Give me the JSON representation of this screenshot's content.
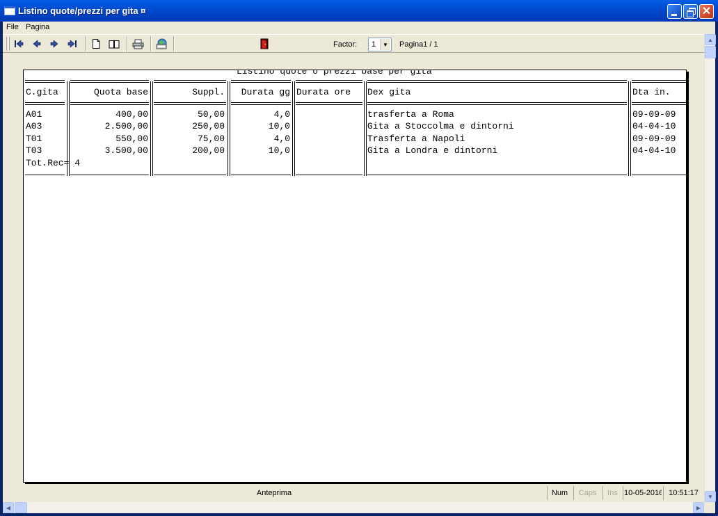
{
  "window": {
    "title": "Listino quote/prezzi per gita ¤",
    "close_glyph": "✕"
  },
  "menu": {
    "items": [
      {
        "label": "File"
      },
      {
        "label": "Pagina"
      }
    ]
  },
  "toolbar": {
    "icons": [
      "first-page-icon",
      "previous-page-icon",
      "next-page-icon",
      "last-page-icon",
      "single-page-icon",
      "two-pages-icon",
      "printer-icon",
      "export-icon",
      "exit-door-icon"
    ],
    "factor_label": "Factor:",
    "factor_value": "1",
    "page_indicator": "Pagina1 / 1"
  },
  "report": {
    "title": "Listino quote o prezzi base per gita",
    "headers": [
      "C.gita",
      "Quota base",
      "Suppl.",
      "Durata gg",
      "Durata ore",
      "Dex gita",
      "Dta in."
    ],
    "rows": [
      {
        "code": "A01",
        "quota": "400,00",
        "suppl": "50,00",
        "gg": "4,0",
        "ore": "",
        "dex": "trasferta a Roma",
        "dta": "09-09-09"
      },
      {
        "code": "A03",
        "quota": "2.500,00",
        "suppl": "250,00",
        "gg": "10,0",
        "ore": "",
        "dex": "Gita a Stoccolma e dintorni",
        "dta": "04-04-10"
      },
      {
        "code": "T01",
        "quota": "550,00",
        "suppl": "75,00",
        "gg": "4,0",
        "ore": "",
        "dex": "Trasferta a Napoli",
        "dta": "09-09-09"
      },
      {
        "code": "T03",
        "quota": "3.500,00",
        "suppl": "200,00",
        "gg": "10,0",
        "ore": "",
        "dex": "Gita a Londra e dintorni",
        "dta": "04-04-10"
      }
    ],
    "total": "Tot.Rec= 4"
  },
  "statusbar": {
    "main": "Anteprima",
    "num": "Num",
    "caps": "Caps",
    "ins": "Ins",
    "date": "10-05-2016",
    "time": "10:51:17"
  },
  "colors": {
    "titlebar": "#0046c8",
    "chrome": "#ece9d8",
    "paper": "#ffffff"
  }
}
